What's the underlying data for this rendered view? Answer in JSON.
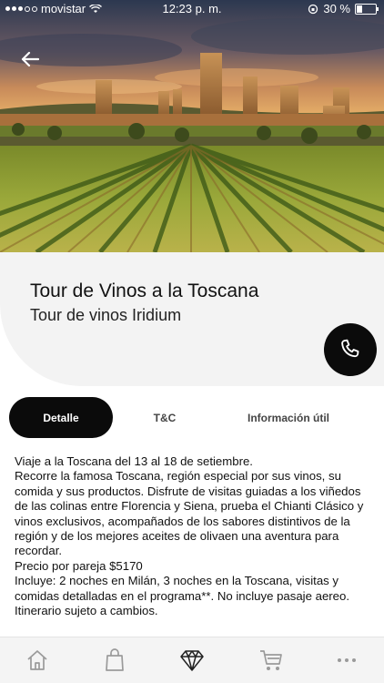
{
  "status_bar": {
    "carrier": "movistar",
    "time": "12:23 p. m.",
    "battery": "30 %",
    "battery_level": 0.3
  },
  "hero": {
    "image": "tuscany-hill-town-vineyard-photo"
  },
  "header": {
    "back_icon": "arrow-left-icon"
  },
  "product": {
    "title": "Tour de Vinos a la Toscana",
    "subtitle": "Tour de vinos Iridium",
    "call_icon": "phone-icon"
  },
  "tabs": [
    {
      "label": "Detalle",
      "active": true
    },
    {
      "label": "T&C",
      "active": false
    },
    {
      "label": "Información útil",
      "active": false
    }
  ],
  "detail": {
    "lines": [
      "Viaje a la Toscana del 13 al 18 de setiembre.",
      "Recorre la famosa Toscana, región especial por sus vinos, su comida y sus productos. Disfrute de visitas guiadas a los viñedos de las colinas entre Florencia y Siena, prueba el Chianti Clásico y vinos exclusivos, acompañados de los sabores distintivos de la región y de los mejores aceites de olivaen una aventura para recordar.",
      "Precio por pareja $5170",
      "Incluye: 2 noches en Milán, 3 noches en la Toscana, visitas y comidas detalladas en el programa**. No incluye pasaje aereo.",
      "Itinerario sujeto a cambios."
    ]
  },
  "bottom_nav": [
    {
      "icon": "home-icon"
    },
    {
      "icon": "shopping-bag-icon"
    },
    {
      "icon": "diamond-icon",
      "active": true
    },
    {
      "icon": "cart-icon"
    },
    {
      "icon": "more-icon"
    }
  ],
  "colors": {
    "accent": "#0b0b0b",
    "card_bg": "#f3f3f3",
    "nav_bg": "#f4f4f4",
    "icon_gray": "#9a9a9a"
  }
}
